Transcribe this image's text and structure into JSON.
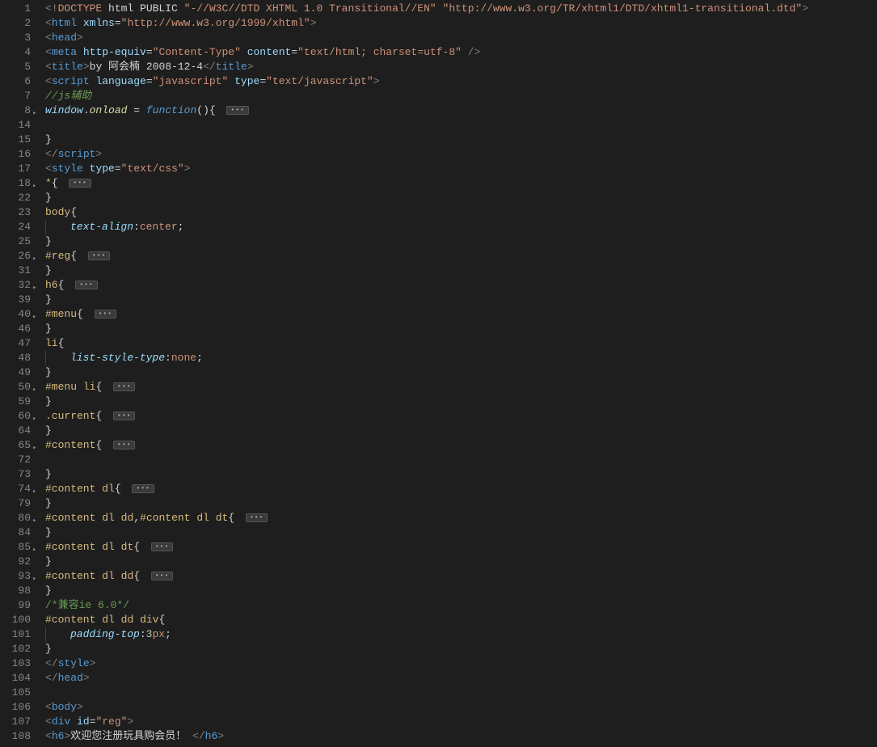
{
  "lines": [
    {
      "num": "1",
      "fold": "",
      "seg": [
        [
          "br",
          "<!"
        ],
        [
          "dtbang",
          "DOCTYPE"
        ],
        [
          "txt",
          " html PUBLIC "
        ],
        [
          "str",
          "\"-//W3C//DTD XHTML 1.0 Transitional//EN\""
        ],
        [
          "txt",
          " "
        ],
        [
          "str",
          "\"http://www.w3.org/TR/xhtml1/DTD/xhtml1-transitional.dtd\""
        ],
        [
          "br",
          ">"
        ]
      ]
    },
    {
      "num": "2",
      "fold": "",
      "seg": [
        [
          "br",
          "<"
        ],
        [
          "tag",
          "html"
        ],
        [
          "txt",
          " "
        ],
        [
          "attr",
          "xmlns"
        ],
        [
          "txt",
          "="
        ],
        [
          "str",
          "\"http://www.w3.org/1999/xhtml\""
        ],
        [
          "br",
          ">"
        ]
      ]
    },
    {
      "num": "3",
      "fold": "",
      "seg": [
        [
          "br",
          "<"
        ],
        [
          "tag",
          "head"
        ],
        [
          "br",
          ">"
        ]
      ]
    },
    {
      "num": "4",
      "fold": "",
      "seg": [
        [
          "br",
          "<"
        ],
        [
          "tag",
          "meta"
        ],
        [
          "txt",
          " "
        ],
        [
          "attr",
          "http-equiv"
        ],
        [
          "txt",
          "="
        ],
        [
          "str",
          "\"Content-Type\""
        ],
        [
          "txt",
          " "
        ],
        [
          "attr",
          "content"
        ],
        [
          "txt",
          "="
        ],
        [
          "str",
          "\"text/html; charset=utf-8\""
        ],
        [
          "txt",
          " "
        ],
        [
          "br",
          "/>"
        ]
      ]
    },
    {
      "num": "5",
      "fold": "",
      "seg": [
        [
          "br",
          "<"
        ],
        [
          "tag",
          "title"
        ],
        [
          "br",
          ">"
        ],
        [
          "txt",
          "by 阿会楠 2008-12-4"
        ],
        [
          "br",
          "</"
        ],
        [
          "tag",
          "title"
        ],
        [
          "br",
          ">"
        ]
      ]
    },
    {
      "num": "6",
      "fold": "",
      "seg": [
        [
          "br",
          "<"
        ],
        [
          "tag",
          "script"
        ],
        [
          "txt",
          " "
        ],
        [
          "attr",
          "language"
        ],
        [
          "txt",
          "="
        ],
        [
          "str",
          "\"javascript\""
        ],
        [
          "txt",
          " "
        ],
        [
          "attr",
          "type"
        ],
        [
          "txt",
          "="
        ],
        [
          "str",
          "\"text/javascript\""
        ],
        [
          "br",
          ">"
        ]
      ]
    },
    {
      "num": "7",
      "fold": "",
      "seg": [
        [
          "cmt",
          "//js辅助"
        ]
      ]
    },
    {
      "num": "8",
      "fold": "▸",
      "seg": [
        [
          "jsvar",
          "window"
        ],
        [
          "punct",
          "."
        ],
        [
          "jsfn",
          "onload"
        ],
        [
          "punct",
          " = "
        ],
        [
          "jskw",
          "function"
        ],
        [
          "punct",
          "(){ "
        ]
      ],
      "ellipsis": true
    },
    {
      "num": "14",
      "fold": "",
      "seg": []
    },
    {
      "num": "15",
      "fold": "",
      "seg": [
        [
          "punct",
          "}"
        ]
      ]
    },
    {
      "num": "16",
      "fold": "",
      "seg": [
        [
          "br",
          "</"
        ],
        [
          "tag",
          "script"
        ],
        [
          "br",
          ">"
        ]
      ]
    },
    {
      "num": "17",
      "fold": "",
      "seg": [
        [
          "br",
          "<"
        ],
        [
          "tag",
          "style"
        ],
        [
          "txt",
          " "
        ],
        [
          "attr",
          "type"
        ],
        [
          "txt",
          "="
        ],
        [
          "str",
          "\"text/css\""
        ],
        [
          "br",
          ">"
        ]
      ]
    },
    {
      "num": "18",
      "fold": "▸",
      "seg": [
        [
          "sel",
          "*"
        ],
        [
          "punct",
          "{ "
        ]
      ],
      "ellipsis": true
    },
    {
      "num": "22",
      "fold": "",
      "seg": [
        [
          "punct",
          "}"
        ]
      ]
    },
    {
      "num": "23",
      "fold": "",
      "seg": [
        [
          "sel",
          "body"
        ],
        [
          "punct",
          "{"
        ]
      ]
    },
    {
      "num": "24",
      "fold": "",
      "indent": 1,
      "seg": [
        [
          "prop",
          "text-align"
        ],
        [
          "punct",
          ":"
        ],
        [
          "val",
          "center"
        ],
        [
          "punct",
          ";"
        ]
      ]
    },
    {
      "num": "25",
      "fold": "",
      "seg": [
        [
          "punct",
          "}"
        ]
      ]
    },
    {
      "num": "26",
      "fold": "▸",
      "seg": [
        [
          "sel",
          "#reg"
        ],
        [
          "punct",
          "{ "
        ]
      ],
      "ellipsis": true
    },
    {
      "num": "31",
      "fold": "",
      "seg": [
        [
          "punct",
          "}"
        ]
      ]
    },
    {
      "num": "32",
      "fold": "▸",
      "seg": [
        [
          "sel",
          "h6"
        ],
        [
          "punct",
          "{ "
        ]
      ],
      "ellipsis": true
    },
    {
      "num": "39",
      "fold": "",
      "seg": [
        [
          "punct",
          "}"
        ]
      ]
    },
    {
      "num": "40",
      "fold": "▸",
      "seg": [
        [
          "sel",
          "#menu"
        ],
        [
          "punct",
          "{ "
        ]
      ],
      "ellipsis": true
    },
    {
      "num": "46",
      "fold": "",
      "seg": [
        [
          "punct",
          "}"
        ]
      ]
    },
    {
      "num": "47",
      "fold": "",
      "seg": [
        [
          "sel",
          "li"
        ],
        [
          "punct",
          "{"
        ]
      ]
    },
    {
      "num": "48",
      "fold": "",
      "indent": 1,
      "seg": [
        [
          "prop",
          "list-style-type"
        ],
        [
          "punct",
          ":"
        ],
        [
          "val",
          "none"
        ],
        [
          "punct",
          ";"
        ]
      ]
    },
    {
      "num": "49",
      "fold": "",
      "seg": [
        [
          "punct",
          "}"
        ]
      ]
    },
    {
      "num": "50",
      "fold": "▸",
      "seg": [
        [
          "sel",
          "#menu"
        ],
        [
          "txt",
          " "
        ],
        [
          "sel",
          "li"
        ],
        [
          "punct",
          "{ "
        ]
      ],
      "ellipsis": true
    },
    {
      "num": "59",
      "fold": "",
      "seg": [
        [
          "punct",
          "}"
        ]
      ]
    },
    {
      "num": "60",
      "fold": "▸",
      "seg": [
        [
          "sel",
          ".current"
        ],
        [
          "punct",
          "{ "
        ]
      ],
      "ellipsis": true
    },
    {
      "num": "64",
      "fold": "",
      "seg": [
        [
          "punct",
          "}"
        ]
      ]
    },
    {
      "num": "65",
      "fold": "▸",
      "seg": [
        [
          "sel",
          "#content"
        ],
        [
          "punct",
          "{ "
        ]
      ],
      "ellipsis": true
    },
    {
      "num": "72",
      "fold": "",
      "seg": []
    },
    {
      "num": "73",
      "fold": "",
      "seg": [
        [
          "punct",
          "}"
        ]
      ]
    },
    {
      "num": "74",
      "fold": "▸",
      "seg": [
        [
          "sel",
          "#content"
        ],
        [
          "txt",
          " "
        ],
        [
          "sel",
          "dl"
        ],
        [
          "punct",
          "{ "
        ]
      ],
      "ellipsis": true
    },
    {
      "num": "79",
      "fold": "",
      "seg": [
        [
          "punct",
          "}"
        ]
      ]
    },
    {
      "num": "80",
      "fold": "▸",
      "seg": [
        [
          "sel",
          "#content"
        ],
        [
          "txt",
          " "
        ],
        [
          "sel",
          "dl"
        ],
        [
          "txt",
          " "
        ],
        [
          "sel",
          "dd"
        ],
        [
          "punct",
          ","
        ],
        [
          "sel",
          "#content"
        ],
        [
          "txt",
          " "
        ],
        [
          "sel",
          "dl"
        ],
        [
          "txt",
          " "
        ],
        [
          "sel",
          "dt"
        ],
        [
          "punct",
          "{ "
        ]
      ],
      "ellipsis": true
    },
    {
      "num": "84",
      "fold": "",
      "seg": [
        [
          "punct",
          "}"
        ]
      ]
    },
    {
      "num": "85",
      "fold": "▸",
      "seg": [
        [
          "sel",
          "#content"
        ],
        [
          "txt",
          " "
        ],
        [
          "sel",
          "dl"
        ],
        [
          "txt",
          " "
        ],
        [
          "sel",
          "dt"
        ],
        [
          "punct",
          "{ "
        ]
      ],
      "ellipsis": true
    },
    {
      "num": "92",
      "fold": "",
      "seg": [
        [
          "punct",
          "}"
        ]
      ]
    },
    {
      "num": "93",
      "fold": "▸",
      "seg": [
        [
          "sel",
          "#content"
        ],
        [
          "txt",
          " "
        ],
        [
          "sel",
          "dl"
        ],
        [
          "txt",
          " "
        ],
        [
          "sel",
          "dd"
        ],
        [
          "punct",
          "{ "
        ]
      ],
      "ellipsis": true
    },
    {
      "num": "98",
      "fold": "",
      "seg": [
        [
          "punct",
          "}"
        ]
      ]
    },
    {
      "num": "99",
      "fold": "",
      "seg": [
        [
          "cmt2",
          "/*兼容ie 6.0*/"
        ]
      ]
    },
    {
      "num": "100",
      "fold": "",
      "seg": [
        [
          "sel",
          "#content"
        ],
        [
          "txt",
          " "
        ],
        [
          "sel",
          "dl"
        ],
        [
          "txt",
          " "
        ],
        [
          "sel",
          "dd"
        ],
        [
          "txt",
          " "
        ],
        [
          "sel",
          "div"
        ],
        [
          "punct",
          "{"
        ]
      ]
    },
    {
      "num": "101",
      "fold": "",
      "indent": 1,
      "seg": [
        [
          "prop",
          "padding-top"
        ],
        [
          "punct",
          ":"
        ],
        [
          "num",
          "3"
        ],
        [
          "selattr",
          "px"
        ],
        [
          "punct",
          ";"
        ]
      ]
    },
    {
      "num": "102",
      "fold": "",
      "seg": [
        [
          "punct",
          "}"
        ]
      ]
    },
    {
      "num": "103",
      "fold": "",
      "seg": [
        [
          "br",
          "</"
        ],
        [
          "tag",
          "style"
        ],
        [
          "br",
          ">"
        ]
      ]
    },
    {
      "num": "104",
      "fold": "",
      "seg": [
        [
          "br",
          "</"
        ],
        [
          "tag",
          "head"
        ],
        [
          "br",
          ">"
        ]
      ]
    },
    {
      "num": "105",
      "fold": "",
      "seg": []
    },
    {
      "num": "106",
      "fold": "",
      "seg": [
        [
          "br",
          "<"
        ],
        [
          "tag",
          "body"
        ],
        [
          "br",
          ">"
        ]
      ]
    },
    {
      "num": "107",
      "fold": "",
      "seg": [
        [
          "br",
          "<"
        ],
        [
          "tag",
          "div"
        ],
        [
          "txt",
          " "
        ],
        [
          "attr",
          "id"
        ],
        [
          "txt",
          "="
        ],
        [
          "str",
          "\"reg\""
        ],
        [
          "br",
          ">"
        ]
      ]
    },
    {
      "num": "108",
      "fold": "",
      "seg": [
        [
          "br",
          "<"
        ],
        [
          "tag",
          "h6"
        ],
        [
          "br",
          ">"
        ],
        [
          "txt",
          "欢迎您注册玩具购会员！ "
        ],
        [
          "br",
          "</"
        ],
        [
          "tag",
          "h6"
        ],
        [
          "br",
          ">"
        ]
      ]
    }
  ],
  "ellipsis_glyph": "•••"
}
